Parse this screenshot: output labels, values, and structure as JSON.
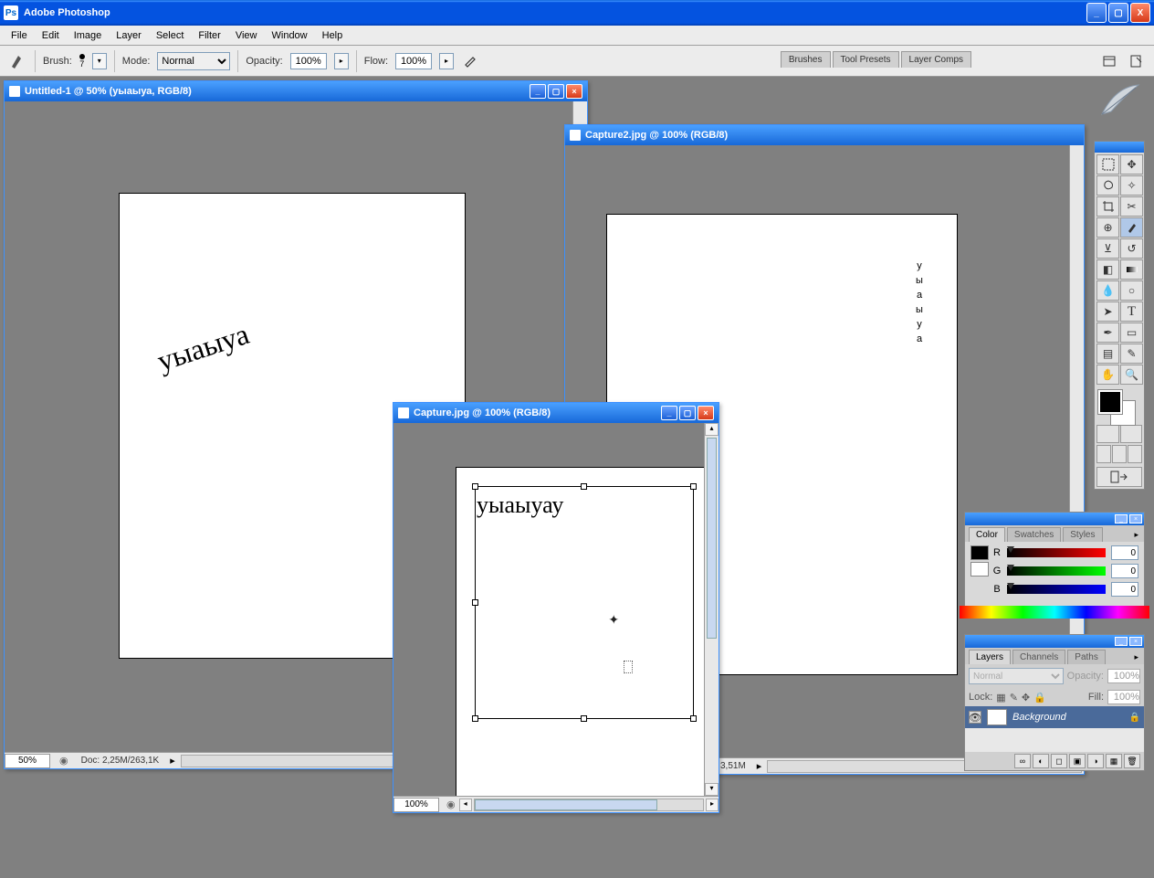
{
  "app": {
    "title": "Adobe Photoshop",
    "window_buttons": {
      "min": "_",
      "max": "▢",
      "close": "X"
    }
  },
  "menu": [
    "File",
    "Edit",
    "Image",
    "Layer",
    "Select",
    "Filter",
    "View",
    "Window",
    "Help"
  ],
  "options": {
    "brush_label": "Brush:",
    "brush_size": "7",
    "mode_label": "Mode:",
    "mode_value": "Normal",
    "opacity_label": "Opacity:",
    "opacity_value": "100%",
    "flow_label": "Flow:",
    "flow_value": "100%"
  },
  "dock_tabs": [
    "Brushes",
    "Tool Presets",
    "Layer Comps"
  ],
  "documents": {
    "doc1": {
      "title": "Untitled-1 @ 50% (уыаыуа, RGB/8)",
      "zoom": "50%",
      "status": "Doc: 2,25M/263,1K",
      "text": "уыаыуа"
    },
    "doc2": {
      "title": "Capture2.jpg @ 100% (RGB/8)",
      "status": "3,51M",
      "text_chars": [
        "у",
        "ы",
        "а",
        "ы",
        "у",
        "а"
      ]
    },
    "doc3": {
      "title": "Capture.jpg @ 100% (RGB/8)",
      "zoom": "100%",
      "text": "уыаыуау"
    }
  },
  "color_panel": {
    "tabs": [
      "Color",
      "Swatches",
      "Styles"
    ],
    "r_label": "R",
    "r_val": "0",
    "g_label": "G",
    "g_val": "0",
    "b_label": "B",
    "b_val": "0"
  },
  "layers_panel": {
    "tabs": [
      "Layers",
      "Channels",
      "Paths"
    ],
    "blend_mode": "Normal",
    "opacity_label": "Opacity:",
    "opacity_value": "100%",
    "lock_label": "Lock:",
    "fill_label": "Fill:",
    "fill_value": "100%",
    "layer_name": "Background"
  },
  "tools": [
    "marquee",
    "move",
    "lasso",
    "wand",
    "crop",
    "slice",
    "heal",
    "brush",
    "stamp",
    "history",
    "eraser",
    "gradient",
    "blur",
    "dodge",
    "path",
    "type",
    "pen",
    "shape",
    "notes",
    "eyedrop",
    "hand",
    "zoom"
  ]
}
